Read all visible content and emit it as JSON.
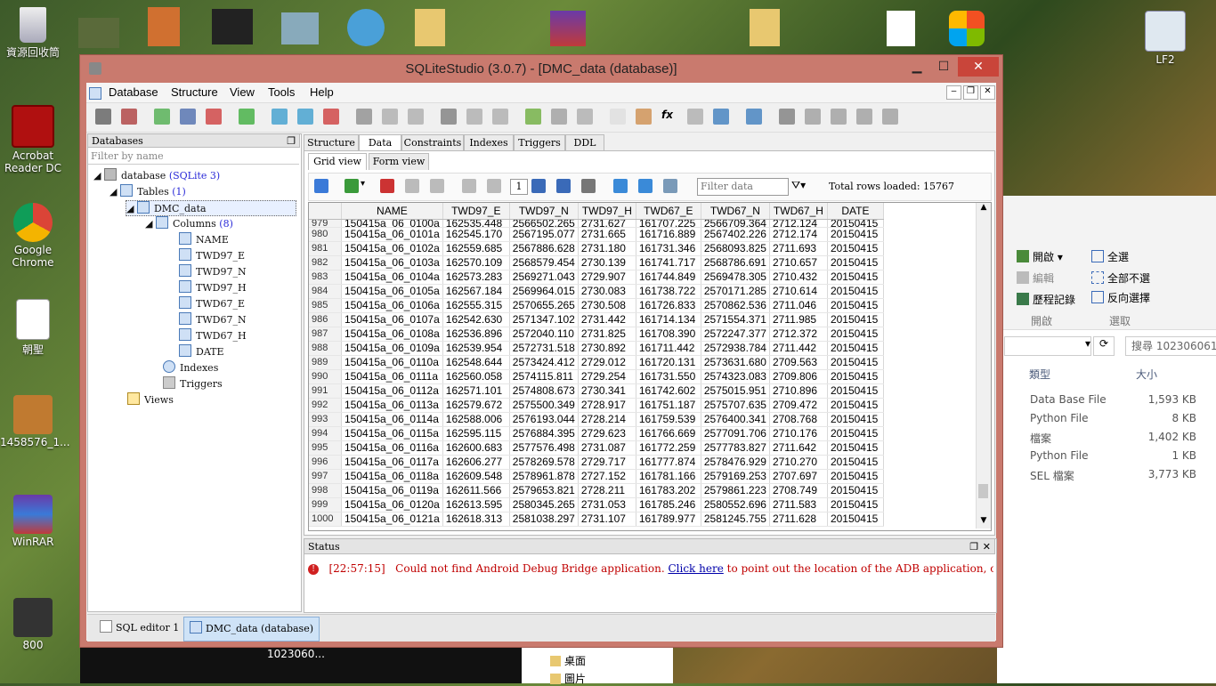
{
  "desktop": {
    "icons": [
      {
        "label": "資源回收筒"
      },
      {
        "label": "Acrobat\nReader DC"
      },
      {
        "label": "Google\nChrome"
      },
      {
        "label": "朝聖"
      },
      {
        "label": "1458576_1..."
      },
      {
        "label": "WinRAR"
      },
      {
        "label": "800"
      },
      {
        "label": "LF2"
      }
    ],
    "bottom_labels": [
      "1023060..."
    ]
  },
  "explorer": {
    "ribbon": {
      "open_label": "開啟",
      "edit_label": "編輯",
      "history_label": "歷程記錄",
      "group_open": "開啟",
      "select_all": "全選",
      "select_none": "全部不選",
      "invert_select": "反向選擇",
      "group_select": "選取"
    },
    "search_placeholder": "搜尋 102306061_...",
    "columns": {
      "type": "類型",
      "size": "大小"
    },
    "files": [
      {
        "type": "Data Base File",
        "size": "1,593 KB"
      },
      {
        "type": "Python File",
        "size": "8 KB"
      },
      {
        "type": "檔案",
        "size": "1,402 KB"
      },
      {
        "type": "Python File",
        "size": "1 KB"
      },
      {
        "type": "SEL 檔案",
        "size": "3,773 KB"
      }
    ],
    "nav_item": "桌面",
    "nav_item2": "圖片"
  },
  "window": {
    "title": "SQLiteStudio (3.0.7) - [DMC_data (database)]",
    "menu": [
      "Database",
      "Structure",
      "View",
      "Tools",
      "Help"
    ],
    "databases_panel": {
      "title": "Databases",
      "filter_placeholder": "Filter by name",
      "db_name": "database",
      "db_type": "(SQLite 3)",
      "tables_label": "Tables",
      "tables_count": "(1)",
      "table_name": "DMC_data",
      "columns_label": "Columns",
      "columns_count": "(8)",
      "columns": [
        "NAME",
        "TWD97_E",
        "TWD97_N",
        "TWD97_H",
        "TWD67_E",
        "TWD67_N",
        "TWD67_H",
        "DATE"
      ],
      "indexes_label": "Indexes",
      "triggers_label": "Triggers",
      "views_label": "Views"
    },
    "tabs": [
      "Structure",
      "Data",
      "Constraints",
      "Indexes",
      "Triggers",
      "DDL"
    ],
    "subtabs": [
      "Grid view",
      "Form view"
    ],
    "grid_toolbar": {
      "page": "1",
      "filter_placeholder": "Filter data",
      "total_rows": "Total rows loaded: 15767"
    },
    "grid": {
      "headers": [
        "NAME",
        "TWD97_E",
        "TWD97_N",
        "TWD97_H",
        "TWD67_E",
        "TWD67_N",
        "TWD67_H",
        "DATE"
      ],
      "rows": [
        [
          "979",
          "150415a_06_0100a",
          "162535.448",
          "2566502.265",
          "2731.627",
          "161707.225",
          "2566709.364",
          "2712.124",
          "20150415"
        ],
        [
          "980",
          "150415a_06_0101a",
          "162545.170",
          "2567195.077",
          "2731.665",
          "161716.889",
          "2567402.226",
          "2712.174",
          "20150415"
        ],
        [
          "981",
          "150415a_06_0102a",
          "162559.685",
          "2567886.628",
          "2731.180",
          "161731.346",
          "2568093.825",
          "2711.693",
          "20150415"
        ],
        [
          "982",
          "150415a_06_0103a",
          "162570.109",
          "2568579.454",
          "2730.139",
          "161741.717",
          "2568786.691",
          "2710.657",
          "20150415"
        ],
        [
          "983",
          "150415a_06_0104a",
          "162573.283",
          "2569271.043",
          "2729.907",
          "161744.849",
          "2569478.305",
          "2710.432",
          "20150415"
        ],
        [
          "984",
          "150415a_06_0105a",
          "162567.184",
          "2569964.015",
          "2730.083",
          "161738.722",
          "2570171.285",
          "2710.614",
          "20150415"
        ],
        [
          "985",
          "150415a_06_0106a",
          "162555.315",
          "2570655.265",
          "2730.508",
          "161726.833",
          "2570862.536",
          "2711.046",
          "20150415"
        ],
        [
          "986",
          "150415a_06_0107a",
          "162542.630",
          "2571347.102",
          "2731.442",
          "161714.134",
          "2571554.371",
          "2711.985",
          "20150415"
        ],
        [
          "987",
          "150415a_06_0108a",
          "162536.896",
          "2572040.110",
          "2731.825",
          "161708.390",
          "2572247.377",
          "2712.372",
          "20150415"
        ],
        [
          "988",
          "150415a_06_0109a",
          "162539.954",
          "2572731.518",
          "2730.892",
          "161711.442",
          "2572938.784",
          "2711.442",
          "20150415"
        ],
        [
          "989",
          "150415a_06_0110a",
          "162548.644",
          "2573424.412",
          "2729.012",
          "161720.131",
          "2573631.680",
          "2709.563",
          "20150415"
        ],
        [
          "990",
          "150415a_06_0111a",
          "162560.058",
          "2574115.811",
          "2729.254",
          "161731.550",
          "2574323.083",
          "2709.806",
          "20150415"
        ],
        [
          "991",
          "150415a_06_0112a",
          "162571.101",
          "2574808.673",
          "2730.341",
          "161742.602",
          "2575015.951",
          "2710.896",
          "20150415"
        ],
        [
          "992",
          "150415a_06_0113a",
          "162579.672",
          "2575500.349",
          "2728.917",
          "161751.187",
          "2575707.635",
          "2709.472",
          "20150415"
        ],
        [
          "993",
          "150415a_06_0114a",
          "162588.006",
          "2576193.044",
          "2728.214",
          "161759.539",
          "2576400.341",
          "2708.768",
          "20150415"
        ],
        [
          "994",
          "150415a_06_0115a",
          "162595.115",
          "2576884.395",
          "2729.623",
          "161766.669",
          "2577091.706",
          "2710.176",
          "20150415"
        ],
        [
          "995",
          "150415a_06_0116a",
          "162600.683",
          "2577576.498",
          "2731.087",
          "161772.259",
          "2577783.827",
          "2711.642",
          "20150415"
        ],
        [
          "996",
          "150415a_06_0117a",
          "162606.277",
          "2578269.578",
          "2729.717",
          "161777.874",
          "2578476.929",
          "2710.270",
          "20150415"
        ],
        [
          "997",
          "150415a_06_0118a",
          "162609.548",
          "2578961.878",
          "2727.152",
          "161781.166",
          "2579169.253",
          "2707.697",
          "20150415"
        ],
        [
          "998",
          "150415a_06_0119a",
          "162611.566",
          "2579653.821",
          "2728.211",
          "161783.202",
          "2579861.223",
          "2708.749",
          "20150415"
        ],
        [
          "999",
          "150415a_06_0120a",
          "162613.595",
          "2580345.265",
          "2731.053",
          "161785.246",
          "2580552.696",
          "2711.583",
          "20150415"
        ],
        [
          "1000",
          "150415a_06_0121a",
          "162618.313",
          "2581038.297",
          "2731.107",
          "161789.977",
          "2581245.755",
          "2711.628",
          "20150415"
        ]
      ]
    },
    "status": {
      "title": "Status",
      "time": "[22:57:15]",
      "message": "Could not find Android Debug Bridge application.",
      "link": "Click here",
      "message_tail": "to point out the location of the ADB application, otherwise the Android SQLite plugi"
    },
    "taskbar": [
      "SQL editor 1",
      "DMC_data (database)"
    ]
  }
}
